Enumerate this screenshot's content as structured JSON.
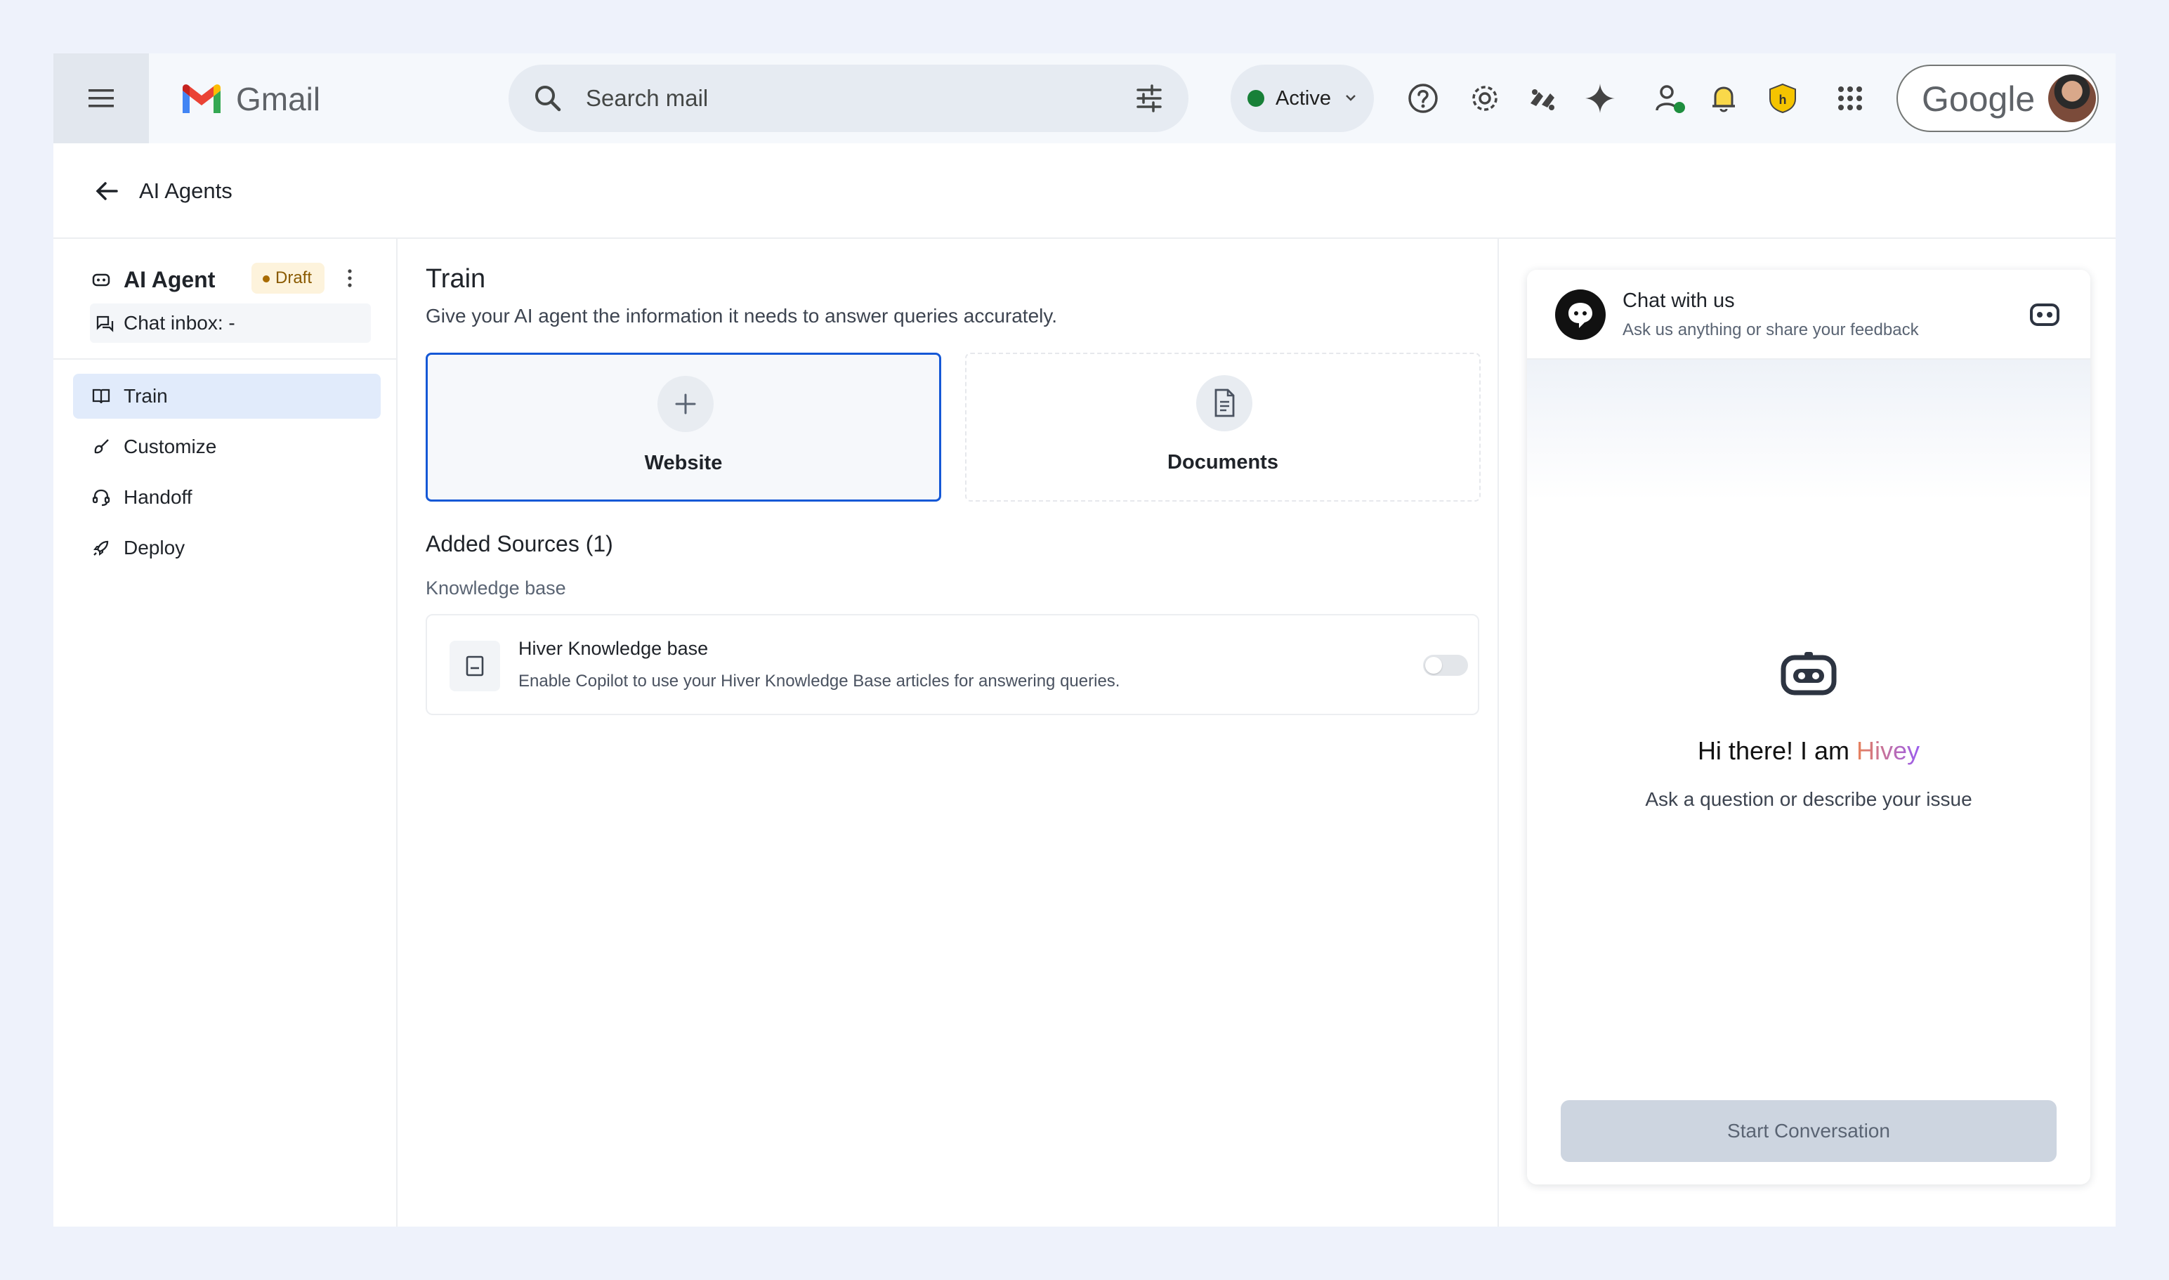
{
  "header": {
    "app_name": "Gmail",
    "search_placeholder": "Search mail",
    "status": {
      "label": "Active",
      "color": "#188038"
    },
    "google_label": "Google",
    "icons": [
      "menu-icon",
      "search-icon",
      "tune-icon",
      "help-icon",
      "settings-icon",
      "apps-script-icon",
      "gemini-icon",
      "contacts-icon",
      "bell-icon",
      "hiver-shield-icon",
      "apps-grid-icon"
    ]
  },
  "page": {
    "back_title": "AI Agents"
  },
  "sidebar": {
    "agent_name": "AI Agent",
    "agent_status": "Draft",
    "chat_inbox": "Chat inbox: -",
    "items": [
      {
        "label": "Train",
        "icon": "book-icon",
        "active": true
      },
      {
        "label": "Customize",
        "icon": "brush-icon",
        "active": false
      },
      {
        "label": "Handoff",
        "icon": "headset-icon",
        "active": false
      },
      {
        "label": "Deploy",
        "icon": "rocket-icon",
        "active": false
      }
    ]
  },
  "train": {
    "title": "Train",
    "description": "Give your AI agent the information it needs to answer queries accurately.",
    "sources": [
      {
        "label": "Website",
        "icon": "plus-icon",
        "selected": true
      },
      {
        "label": "Documents",
        "icon": "document-icon",
        "selected": false
      }
    ],
    "added_title": "Added Sources (1)",
    "kb_section": "Knowledge base",
    "kb_item": {
      "title": "Hiver Knowledge base",
      "description": "Enable Copilot to use your Hiver Knowledge Base articles for answering queries.",
      "enabled": false
    }
  },
  "chat": {
    "title": "Chat with us",
    "subtitle": "Ask us anything or share your feedback",
    "greeting_prefix": "Hi there! I am ",
    "greeting_name": "Hivey",
    "prompt": "Ask a question or describe your issue",
    "start_button": "Start Conversation"
  },
  "colors": {
    "accent": "#1558d6",
    "active_nav": "#e1ebfb",
    "draft_badge": "#fdf3dc"
  }
}
